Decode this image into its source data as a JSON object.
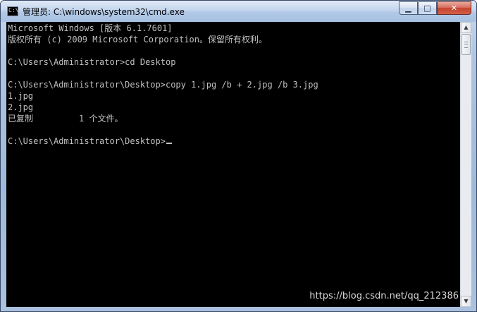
{
  "window": {
    "title": "管理员: C:\\windows\\system32\\cmd.exe",
    "app_icon": "cmd-console-icon",
    "app_icon_glyph": "C:\\",
    "controls": {
      "minimize": "minimize-icon",
      "maximize": "maximize-icon",
      "close": "close-icon",
      "minimize_glyph": "▁",
      "maximize_glyph": "□",
      "close_glyph": "✕"
    }
  },
  "console": {
    "background": "#000000",
    "foreground": "#c0c0c0",
    "lines": [
      "Microsoft Windows [版本 6.1.7601]",
      "版权所有 (c) 2009 Microsoft Corporation。保留所有权利。",
      "",
      "C:\\Users\\Administrator>cd Desktop",
      "",
      "C:\\Users\\Administrator\\Desktop>copy 1.jpg /b + 2.jpg /b 3.jpg",
      "1.jpg",
      "2.jpg",
      "已复制         1 个文件。",
      "",
      "C:\\Users\\Administrator\\Desktop>"
    ],
    "cursor": "_"
  },
  "scrollbar": {
    "up_arrow": "▲",
    "down_arrow": "▼"
  },
  "watermark": "https://blog.csdn.net/qq_212386"
}
